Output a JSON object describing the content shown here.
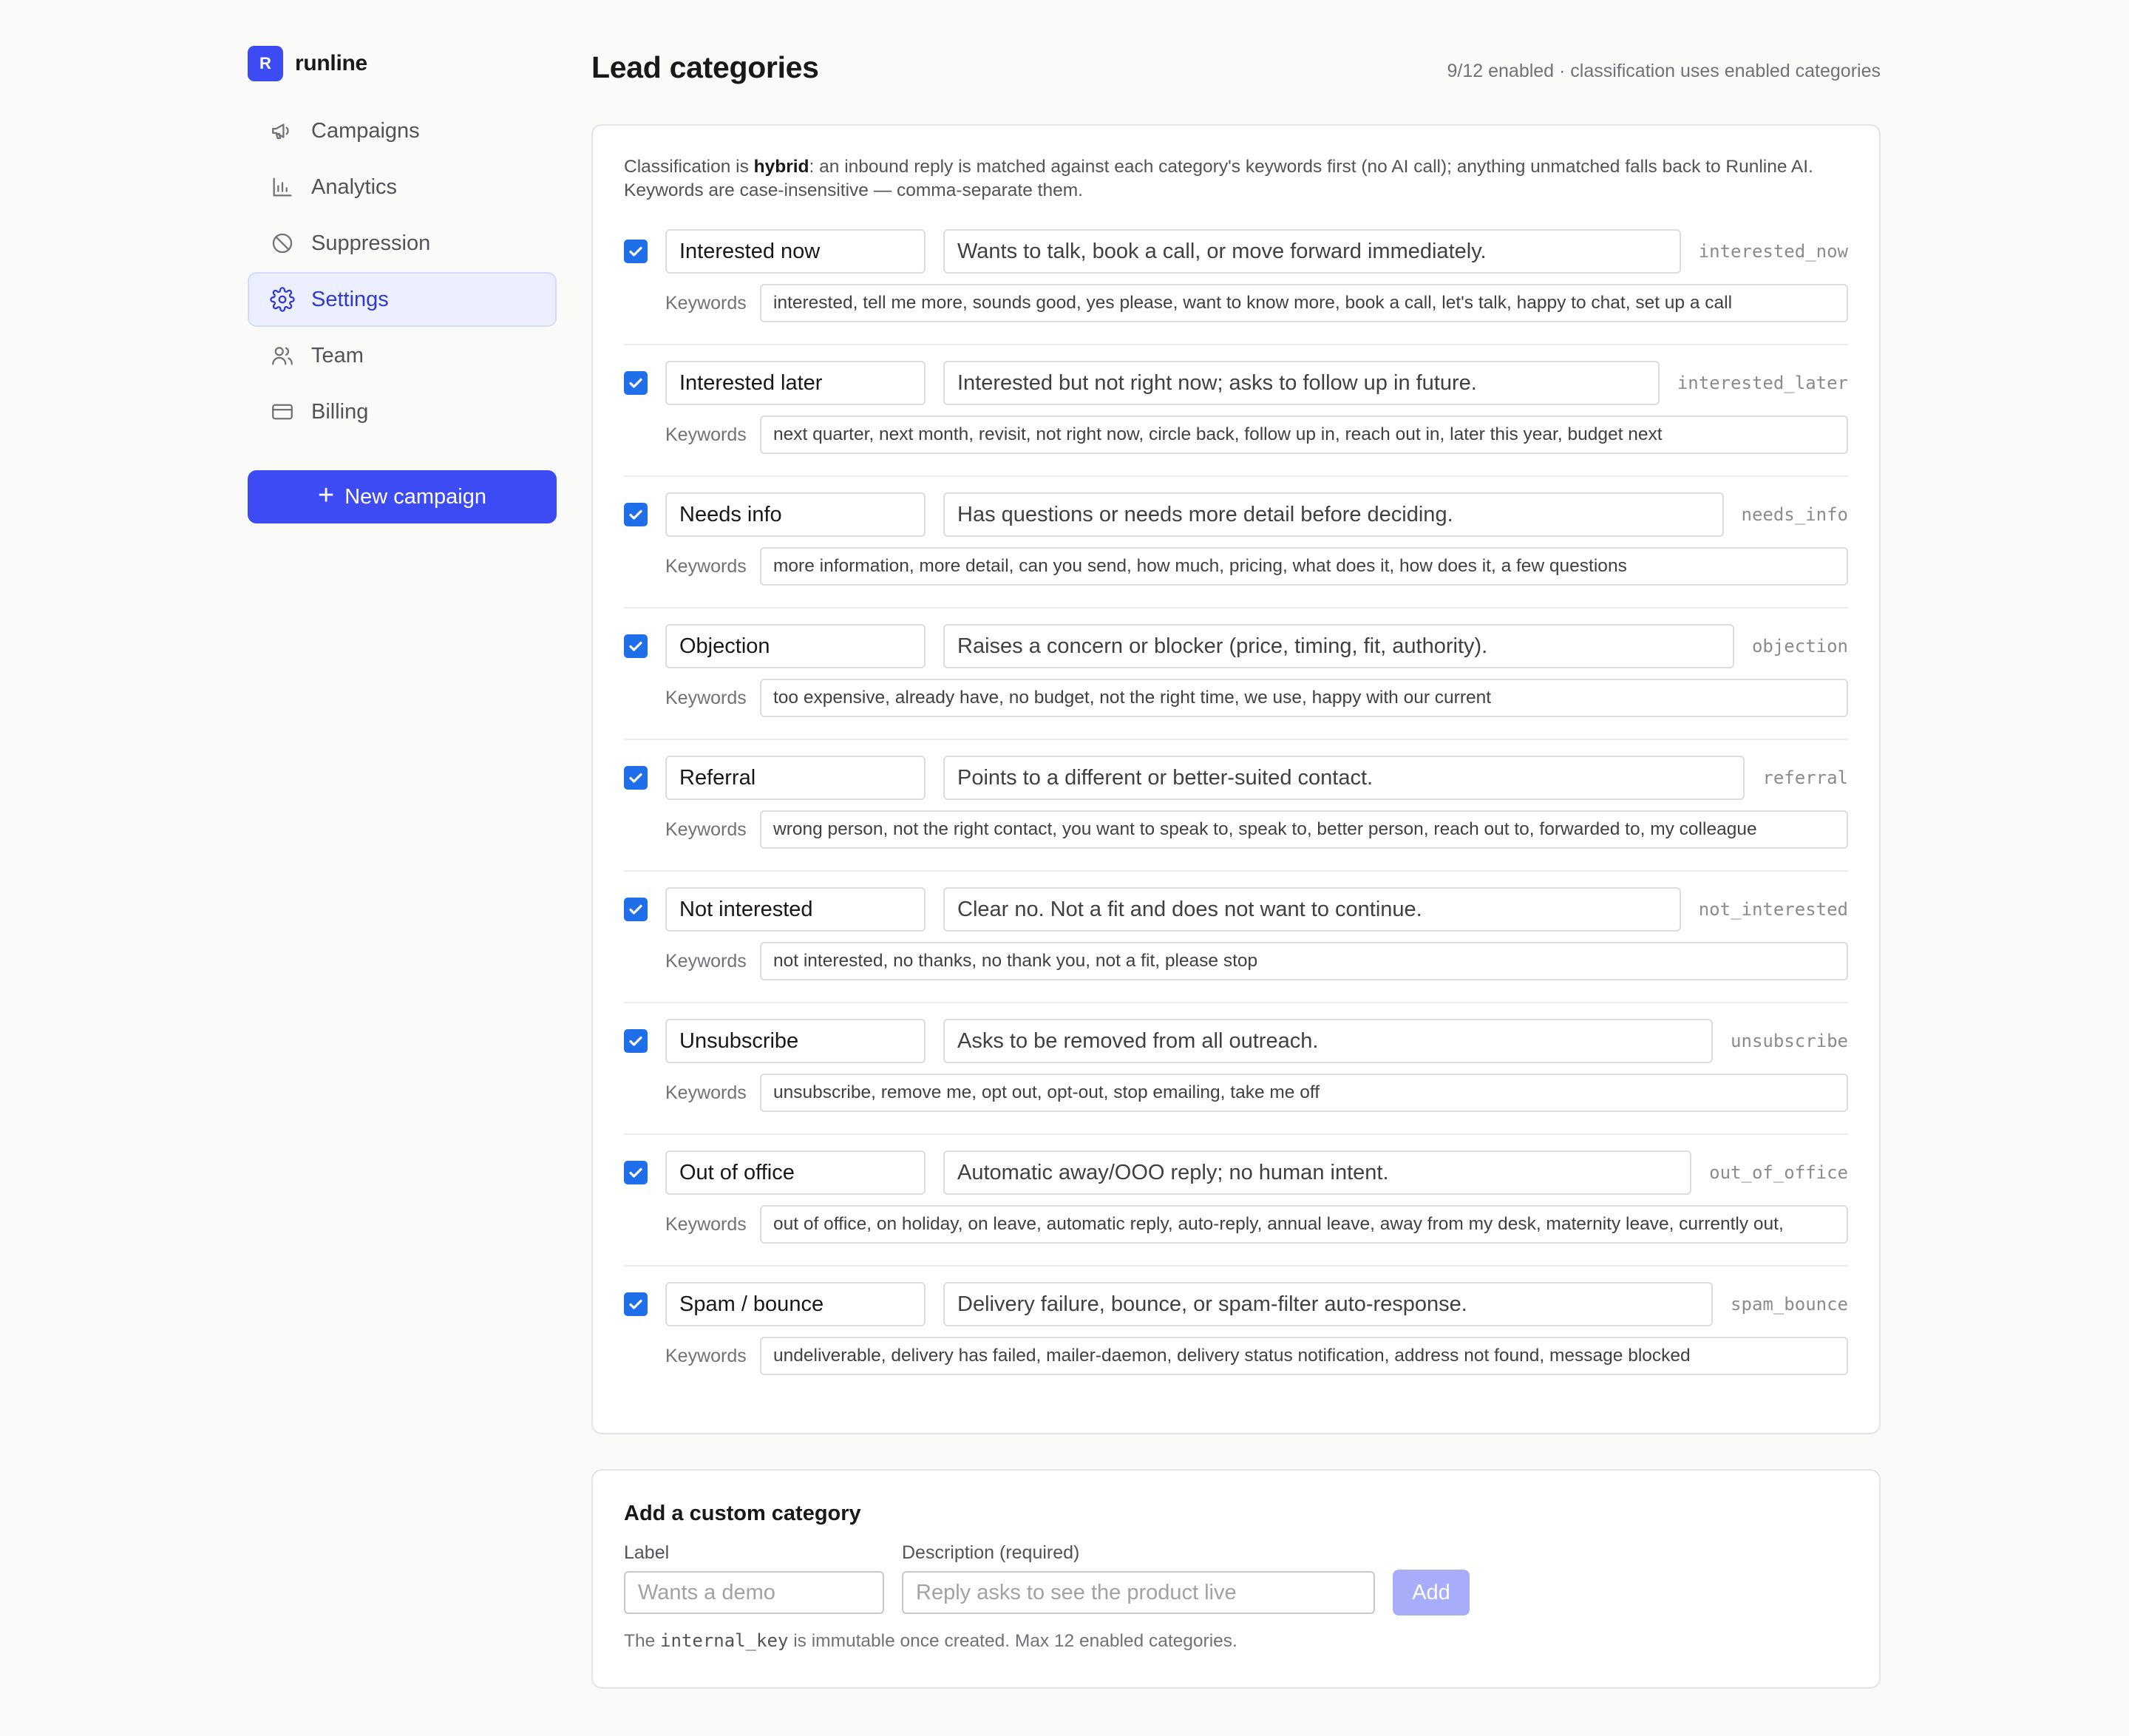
{
  "brand": {
    "logo_letter": "R",
    "name": "runline",
    "accent": "#3d4bf5"
  },
  "sidebar": {
    "items": [
      {
        "label": "Campaigns",
        "icon": "megaphone-icon",
        "active": false
      },
      {
        "label": "Analytics",
        "icon": "bar-chart-icon",
        "active": false
      },
      {
        "label": "Suppression",
        "icon": "ban-icon",
        "active": false
      },
      {
        "label": "Settings",
        "icon": "gear-icon",
        "active": true
      },
      {
        "label": "Team",
        "icon": "users-icon",
        "active": false
      },
      {
        "label": "Billing",
        "icon": "credit-card-icon",
        "active": false
      }
    ],
    "new_campaign_label": "New campaign"
  },
  "main": {
    "title": "Lead categories",
    "meta": "9/12 enabled · classification uses enabled categories",
    "intro": {
      "pre": "Classification is ",
      "bold": "hybrid",
      "post": ": an inbound reply is matched against each category's keywords first (no AI call); anything unmatched falls back to Runline AI. Keywords are case-insensitive — comma-separate them."
    },
    "keywords_label": "Keywords",
    "categories": [
      {
        "enabled": true,
        "label": "Interested now",
        "description": "Wants to talk, book a call, or move forward immediately.",
        "key": "interested_now",
        "keywords": "interested, tell me more, sounds good, yes please, want to know more, book a call, let's talk, happy to chat, set up a call"
      },
      {
        "enabled": true,
        "label": "Interested later",
        "description": "Interested but not right now; asks to follow up in future.",
        "key": "interested_later",
        "keywords": "next quarter, next month, revisit, not right now, circle back, follow up in, reach out in, later this year, budget next"
      },
      {
        "enabled": true,
        "label": "Needs info",
        "description": "Has questions or needs more detail before deciding.",
        "key": "needs_info",
        "keywords": "more information, more detail, can you send, how much, pricing, what does it, how does it, a few questions"
      },
      {
        "enabled": true,
        "label": "Objection",
        "description": "Raises a concern or blocker (price, timing, fit, authority).",
        "key": "objection",
        "keywords": "too expensive, already have, no budget, not the right time, we use, happy with our current"
      },
      {
        "enabled": true,
        "label": "Referral",
        "description": "Points to a different or better-suited contact.",
        "key": "referral",
        "keywords": "wrong person, not the right contact, you want to speak to, speak to, better person, reach out to, forwarded to, my colleague"
      },
      {
        "enabled": true,
        "label": "Not interested",
        "description": "Clear no. Not a fit and does not want to continue.",
        "key": "not_interested",
        "keywords": "not interested, no thanks, no thank you, not a fit, please stop"
      },
      {
        "enabled": true,
        "label": "Unsubscribe",
        "description": "Asks to be removed from all outreach.",
        "key": "unsubscribe",
        "keywords": "unsubscribe, remove me, opt out, opt-out, stop emailing, take me off"
      },
      {
        "enabled": true,
        "label": "Out of office",
        "description": "Automatic away/OOO reply; no human intent.",
        "key": "out_of_office",
        "keywords": "out of office, on holiday, on leave, automatic reply, auto-reply, annual leave, away from my desk, maternity leave, currently out,"
      },
      {
        "enabled": true,
        "label": "Spam / bounce",
        "description": "Delivery failure, bounce, or spam-filter auto-response.",
        "key": "spam_bounce",
        "keywords": "undeliverable, delivery has failed, mailer-daemon, delivery status notification, address not found, message blocked"
      }
    ]
  },
  "add_category": {
    "title": "Add a custom category",
    "label_field": {
      "label": "Label",
      "placeholder": "Wants a demo"
    },
    "description_field": {
      "label": "Description (required)",
      "placeholder": "Reply asks to see the product live"
    },
    "add_label": "Add",
    "note_pre": "The ",
    "note_code": "internal_key",
    "note_post": " is immutable once created. Max 12 enabled categories."
  }
}
